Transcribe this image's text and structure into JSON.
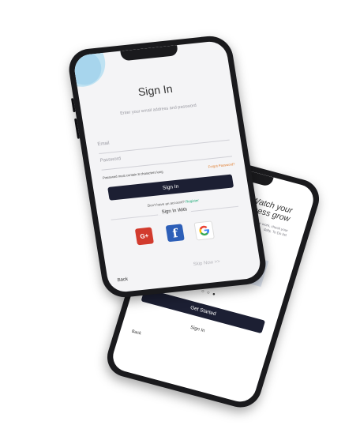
{
  "signin_screen": {
    "title": "Sign In",
    "subtitle": "Enter your email address and password",
    "email_placeholder": "Email",
    "password_placeholder": "Password",
    "password_hint": "Password must contain 8 characters long",
    "forgot_label": "Forgot Password?",
    "signin_button": "Sign In",
    "no_account_text": "Don't have an account?",
    "register_link": "Register",
    "sign_in_with": "Sign In  With",
    "social": [
      {
        "name": "google-plus",
        "glyph": "G+",
        "color": "#d23b2e"
      },
      {
        "name": "facebook",
        "glyph": "f",
        "color": "#2d5fb8"
      },
      {
        "name": "google",
        "glyph": "",
        "color": "#ffffff"
      }
    ],
    "back_label": "Back",
    "skip_label": "Skip Now >>"
  },
  "onboarding_screen": {
    "title_line1": "Watch your",
    "title_line2": "Business grow",
    "subtitle": "maintaines the work, check your daily, To Do list",
    "dots": "○ ○ ●",
    "primary_button": "Get Started",
    "signin_link": "Sign In",
    "back_label": "Back"
  },
  "colors": {
    "button_dark": "#1c1f33",
    "accent_orange": "#e07b2a",
    "accent_green": "#19a974",
    "blob_blue": "#bfe2f2"
  }
}
